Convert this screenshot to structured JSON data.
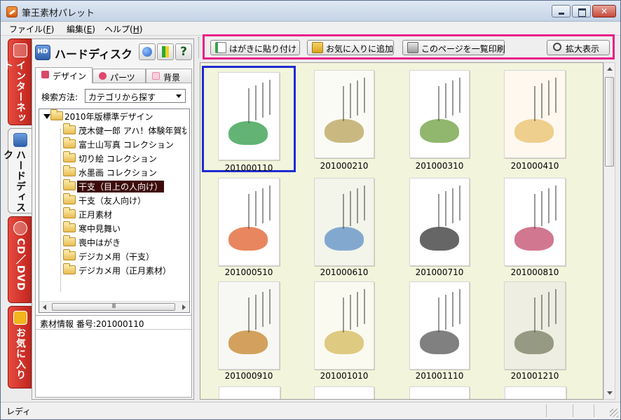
{
  "window": {
    "title": "筆王素材パレット",
    "buttons": {
      "close_glyph": "✕"
    }
  },
  "menu": {
    "items": [
      {
        "label": "ファイル(",
        "key": "F",
        "suffix": ")"
      },
      {
        "label": "編集(",
        "key": "E",
        "suffix": ")"
      },
      {
        "label": "ヘルプ(",
        "key": "H",
        "suffix": ")"
      }
    ]
  },
  "side_tabs": [
    {
      "label": "インターネット",
      "active": false
    },
    {
      "label": "ハードディスク",
      "active": true
    },
    {
      "label": "CD／DVD",
      "active": false
    },
    {
      "label": "お気に入り",
      "active": false
    }
  ],
  "panel": {
    "title": "ハードディスク",
    "help_glyph": "?",
    "tabs": [
      {
        "label": "デザイン",
        "color": "#d64a6a"
      },
      {
        "label": "パーツ",
        "color": "#e0476d"
      },
      {
        "label": "背景",
        "color": "#e88aa8"
      }
    ],
    "search_label": "検索方法:",
    "search_value": "カテゴリから探す",
    "tree_root": "2010年版標準デザイン",
    "tree_items": [
      "茂木健一郎 アハ！体験年賀状",
      "富士山写真 コレクション",
      "切り絵 コレクション",
      "水墨画 コレクション",
      "干支（目上の人向け）",
      "干支（友人向け）",
      "正月素材",
      "寒中見舞い",
      "喪中はがき",
      "デジカメ用（干支）",
      "デジカメ用（正月素材）"
    ],
    "selected_index": 4,
    "scroll_thumb_glyph": "III",
    "info_text": "素材情報 番号:201000110"
  },
  "toolbar": {
    "paste_label": "はがきに貼り付け",
    "favorite_label": "お気に入りに追加",
    "print_label": "このページを一覧印刷",
    "zoom_label": "拡大表示",
    "highlight_color": "#ea1f8a"
  },
  "grid": {
    "selected_index": 0,
    "items": [
      "201000110",
      "201000210",
      "201000310",
      "201000410",
      "201000510",
      "201000610",
      "201000710",
      "201000810",
      "201000910",
      "201001010",
      "201001110",
      "201001210"
    ]
  },
  "status": {
    "text": "レディ"
  }
}
